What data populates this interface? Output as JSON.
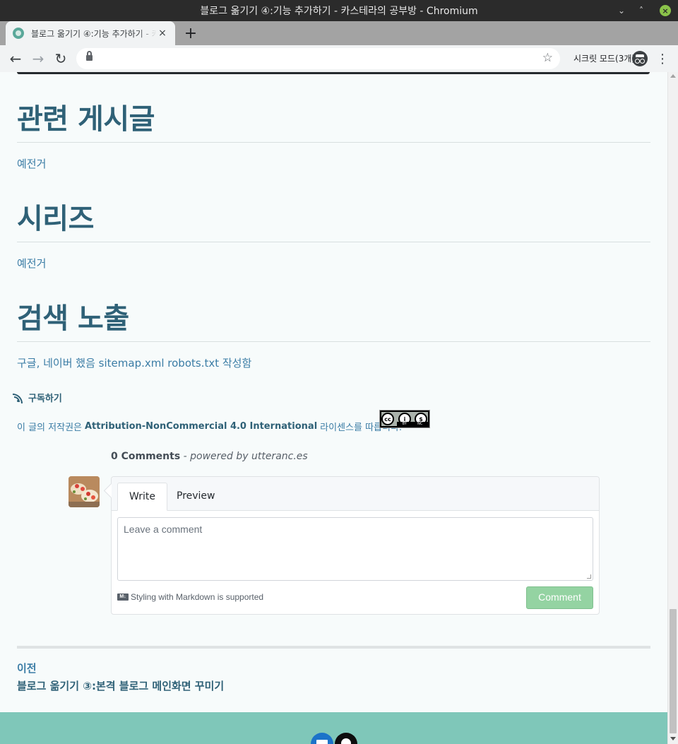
{
  "window": {
    "title": "블로그 옮기기 ④:기능 추가하기 - 카스테라의 공부방 - Chromium"
  },
  "tab": {
    "title": "블로그 옮기기 ④:기능 추가하기 - 카",
    "close": "×",
    "new_tab": "+"
  },
  "toolbar": {
    "back": "←",
    "forward": "→",
    "reload": "↻",
    "url": "",
    "star": "☆",
    "incognito_label": "시크릿 모드(3개)",
    "menu": "⋮"
  },
  "sections": [
    {
      "heading": "관련 게시글",
      "body": "예전거"
    },
    {
      "heading": "시리즈",
      "body": "예전거"
    },
    {
      "heading": "검색 노출",
      "body": "구글, 네이버 했음 sitemap.xml robots.txt 작성함"
    }
  ],
  "subscribe": {
    "label": "구독하기",
    "icon": "rss-icon"
  },
  "license": {
    "prefix": "이 글의 저작권은",
    "name": "Attribution-NonCommercial 4.0 International",
    "suffix": "라이센스를 따릅니다.",
    "badge": {
      "cc": "cc",
      "by": "BY",
      "nc": "NC"
    }
  },
  "comments": {
    "count": "0 Comments",
    "powered_by": " - powered by utteranc.es",
    "tabs": [
      "Write",
      "Preview"
    ],
    "placeholder": "Leave a comment",
    "markdown_note": "Styling with Markdown is supported",
    "markdown_icon": "M↓",
    "submit": "Comment"
  },
  "pagination": {
    "prev_label": "이전",
    "prev_title": "블로그 옮기기 ③:본격 블로그 메인화면 꾸미기"
  },
  "footer": {
    "icons": [
      "mail-icon",
      "github-icon"
    ]
  },
  "colors": {
    "heading": "#2f6177",
    "link": "#3a7ca5",
    "footer": "#7fc7b9",
    "comment_button": "#94d3a2"
  }
}
